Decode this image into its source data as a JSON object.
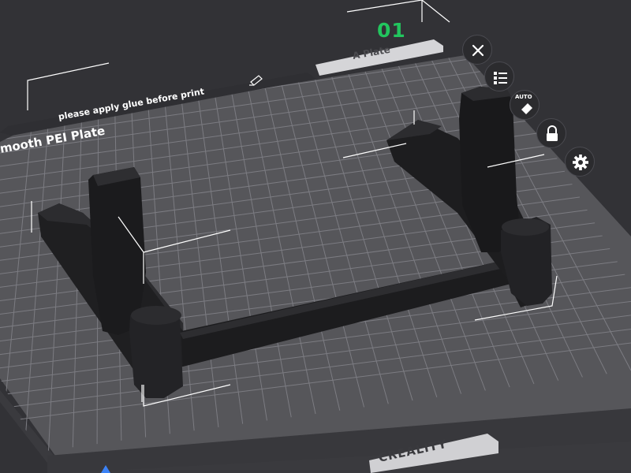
{
  "plate": {
    "number": "01",
    "name": "A Plate",
    "type_label": "mooth PEI Plate",
    "glue_notice": "please apply glue before print",
    "brand": "CREALITY"
  },
  "toolbar": [
    {
      "name": "close-plate-button",
      "icon": "close-icon"
    },
    {
      "name": "arrange-list-button",
      "icon": "list-icon"
    },
    {
      "name": "auto-orient-button",
      "icon": "auto-orient-icon",
      "label": "AUTO"
    },
    {
      "name": "lock-plate-button",
      "icon": "lock-icon"
    },
    {
      "name": "plate-settings-button",
      "icon": "gear-icon"
    }
  ],
  "colors": {
    "background": "#323236",
    "plate_surface": "#56565a",
    "grid_line": "#808085",
    "model": "#1b1b1d",
    "plate_number": "#22c55e",
    "text": "#ffffff"
  }
}
